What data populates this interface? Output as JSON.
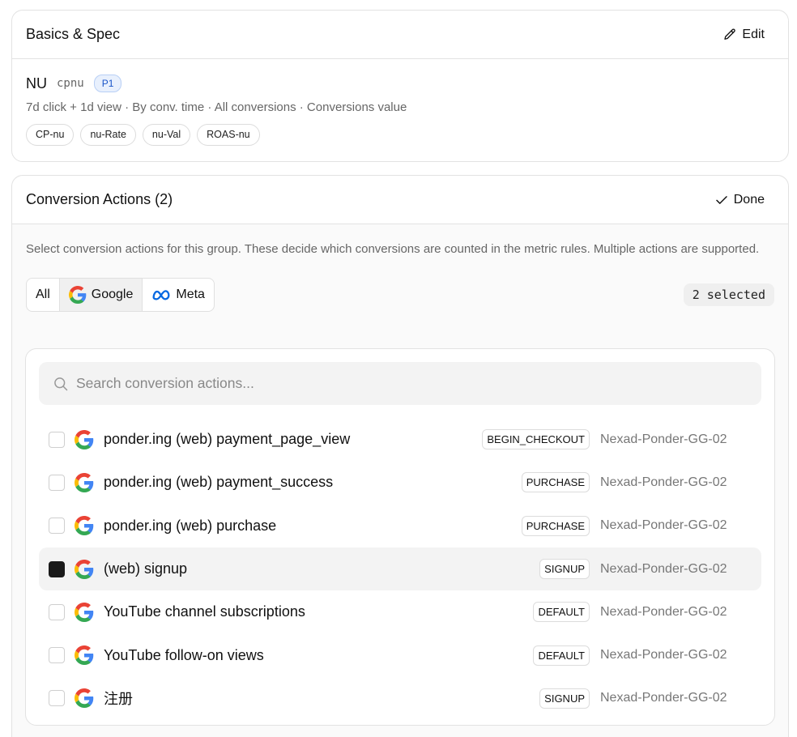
{
  "basics": {
    "title": "Basics & Spec",
    "edit_label": "Edit",
    "name": "NU",
    "code": "cpnu",
    "priority": "P1",
    "description": "7d click + 1d view · By conv. time · All conversions · Conversions value",
    "chips": [
      "CP-nu",
      "nu-Rate",
      "nu-Val",
      "ROAS-nu"
    ]
  },
  "conversions": {
    "title": "Conversion Actions (2)",
    "done_label": "Done",
    "help_text": "Select conversion actions for this group. These decide which conversions are counted in the metric rules. Multiple actions are supported.",
    "filters": [
      {
        "label": "All",
        "icon": "",
        "active": false
      },
      {
        "label": "Google",
        "icon": "google-icon",
        "active": true
      },
      {
        "label": "Meta",
        "icon": "meta-icon",
        "active": false
      }
    ],
    "selected_count": "2 selected",
    "search_placeholder": "Search conversion actions...",
    "rows": [
      {
        "name": "ponder.ing (web) payment_page_view",
        "type": "BEGIN_CHECKOUT",
        "account": "Nexad-Ponder-GG-02",
        "checked": false
      },
      {
        "name": "ponder.ing (web) payment_success",
        "type": "PURCHASE",
        "account": "Nexad-Ponder-GG-02",
        "checked": false
      },
      {
        "name": "ponder.ing (web) purchase",
        "type": "PURCHASE",
        "account": "Nexad-Ponder-GG-02",
        "checked": false
      },
      {
        "name": "(web) signup",
        "type": "SIGNUP",
        "account": "Nexad-Ponder-GG-02",
        "checked": true
      },
      {
        "name": "YouTube channel subscriptions",
        "type": "DEFAULT",
        "account": "Nexad-Ponder-GG-02",
        "checked": false
      },
      {
        "name": "YouTube follow-on views",
        "type": "DEFAULT",
        "account": "Nexad-Ponder-GG-02",
        "checked": false
      },
      {
        "name": "注册",
        "type": "SIGNUP",
        "account": "Nexad-Ponder-GG-02",
        "checked": false
      }
    ]
  },
  "colors": {
    "google_blue": "#4285F4",
    "google_red": "#EA4335",
    "google_yellow": "#FBBC05",
    "google_green": "#34A853",
    "meta_blue": "#0668E1"
  }
}
